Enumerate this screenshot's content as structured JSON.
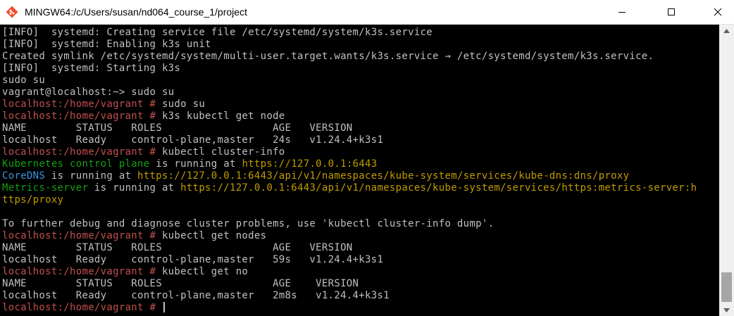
{
  "window": {
    "title": "MINGW64:/c/Users/susan/nd064_course_1/project",
    "icon": "git-bash-icon",
    "controls": [
      "minimize-icon",
      "maximize-icon",
      "close-icon"
    ]
  },
  "colors": {
    "background": "#000000",
    "text": "#c0c0c0",
    "prompt": "#c0504d",
    "green": "#13a10e",
    "cyan": "#3a96dd",
    "url": "#c19c00"
  },
  "terminal": {
    "lines": [
      [
        {
          "t": "[INFO]  systemd: Creating service file /etc/systemd/system/k3s.service",
          "c": "text"
        }
      ],
      [
        {
          "t": "[INFO]  systemd: Enabling k3s unit",
          "c": "text"
        }
      ],
      [
        {
          "t": "Created symlink /etc/systemd/system/multi-user.target.wants/k3s.service → /etc/systemd/system/k3s.service.",
          "c": "text"
        }
      ],
      [
        {
          "t": "[INFO]  systemd: Starting k3s",
          "c": "text"
        }
      ],
      [
        {
          "t": "sudo su",
          "c": "text"
        }
      ],
      [
        {
          "t": "vagrant@localhost:~> sudo su",
          "c": "text"
        }
      ],
      [
        {
          "t": "localhost:/home/vagrant # ",
          "c": "prompt"
        },
        {
          "t": "sudo su",
          "c": "text"
        }
      ],
      [
        {
          "t": "localhost:/home/vagrant # ",
          "c": "prompt"
        },
        {
          "t": "k3s kubectl get node",
          "c": "text"
        }
      ],
      [
        {
          "t": "NAME        STATUS   ROLES                  AGE   VERSION",
          "c": "text"
        }
      ],
      [
        {
          "t": "localhost   Ready    control-plane,master   24s   v1.24.4+k3s1",
          "c": "text"
        }
      ],
      [
        {
          "t": "localhost:/home/vagrant # ",
          "c": "prompt"
        },
        {
          "t": "kubectl cluster-info",
          "c": "text"
        }
      ],
      [
        {
          "t": "Kubernetes control plane",
          "c": "green"
        },
        {
          "t": " is running at ",
          "c": "text"
        },
        {
          "t": "https://127.0.0.1:6443",
          "c": "url"
        }
      ],
      [
        {
          "t": "CoreDNS",
          "c": "cyan"
        },
        {
          "t": " is running at ",
          "c": "text"
        },
        {
          "t": "https://127.0.0.1:6443/api/v1/namespaces/kube-system/services/kube-dns:dns/proxy",
          "c": "url"
        }
      ],
      [
        {
          "t": "Metrics-server",
          "c": "green"
        },
        {
          "t": " is running at ",
          "c": "text"
        },
        {
          "t": "https://127.0.0.1:6443/api/v1/namespaces/kube-system/services/https:metrics-server:h",
          "c": "url"
        }
      ],
      [
        {
          "t": "ttps/proxy",
          "c": "url"
        }
      ],
      [
        {
          "t": "",
          "c": "text"
        }
      ],
      [
        {
          "t": "To further debug and diagnose cluster problems, use 'kubectl cluster-info dump'.",
          "c": "text"
        }
      ],
      [
        {
          "t": "localhost:/home/vagrant # ",
          "c": "prompt"
        },
        {
          "t": "kubectl get nodes",
          "c": "text"
        }
      ],
      [
        {
          "t": "NAME        STATUS   ROLES                  AGE   VERSION",
          "c": "text"
        }
      ],
      [
        {
          "t": "localhost   Ready    control-plane,master   59s   v1.24.4+k3s1",
          "c": "text"
        }
      ],
      [
        {
          "t": "localhost:/home/vagrant # ",
          "c": "prompt"
        },
        {
          "t": "kubectl get no",
          "c": "text"
        }
      ],
      [
        {
          "t": "NAME        STATUS   ROLES                  AGE    VERSION",
          "c": "text"
        }
      ],
      [
        {
          "t": "localhost   Ready    control-plane,master   2m8s   v1.24.4+k3s1",
          "c": "text"
        }
      ],
      [
        {
          "t": "localhost:/home/vagrant # ",
          "c": "prompt"
        }
      ]
    ]
  }
}
